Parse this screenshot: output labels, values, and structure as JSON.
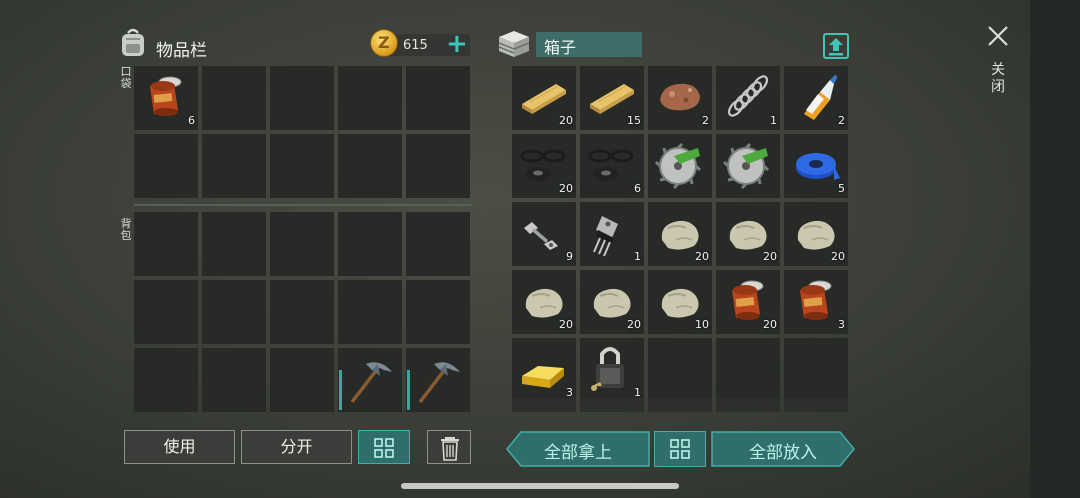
{
  "inventory": {
    "title": "物品栏",
    "currency": "615",
    "pocket_label": "口袋",
    "backpack_label": "背包",
    "pocket": [
      {
        "icon": "canned-food",
        "qty": "6"
      },
      null,
      null,
      null,
      null,
      null,
      null,
      null,
      null,
      null
    ],
    "backpack": [
      null,
      null,
      null,
      null,
      null,
      null,
      null,
      null,
      null,
      null,
      null,
      null,
      null,
      {
        "icon": "pickaxe",
        "qty": ""
      },
      {
        "icon": "pickaxe",
        "qty": ""
      }
    ]
  },
  "box": {
    "title": "箱子",
    "items": [
      {
        "icon": "wood-plank",
        "qty": "20"
      },
      {
        "icon": "wood-plank",
        "qty": "15"
      },
      {
        "icon": "iron-ore",
        "qty": "2"
      },
      {
        "icon": "spring",
        "qty": "1"
      },
      {
        "icon": "glue",
        "qty": "2"
      },
      {
        "icon": "rubber-parts",
        "qty": "20"
      },
      {
        "icon": "rubber-parts",
        "qty": "6"
      },
      {
        "icon": "saw-blade",
        "qty": ""
      },
      {
        "icon": "saw-blade",
        "qty": ""
      },
      {
        "icon": "blue-tape",
        "qty": "5"
      },
      {
        "icon": "bolts",
        "qty": "9"
      },
      {
        "icon": "transistor",
        "qty": "1"
      },
      {
        "icon": "stone",
        "qty": "20"
      },
      {
        "icon": "stone",
        "qty": "20"
      },
      {
        "icon": "stone",
        "qty": "20"
      },
      {
        "icon": "stone",
        "qty": "20"
      },
      {
        "icon": "stone",
        "qty": "20"
      },
      {
        "icon": "stone",
        "qty": "10"
      },
      {
        "icon": "canned-food",
        "qty": "20"
      },
      {
        "icon": "canned-food",
        "qty": "3"
      },
      {
        "icon": "gold-bar",
        "qty": "3"
      },
      {
        "icon": "padlock",
        "qty": "1"
      },
      null,
      null,
      null
    ]
  },
  "close_label": "关闭",
  "buttons": {
    "use": "使用",
    "split": "分开",
    "take_all": "全部拿上",
    "put_all": "全部放入"
  },
  "colors": {
    "accent": "#3fb0a8",
    "accent_fill": "#2f6e6a",
    "slot": "#272a27"
  }
}
